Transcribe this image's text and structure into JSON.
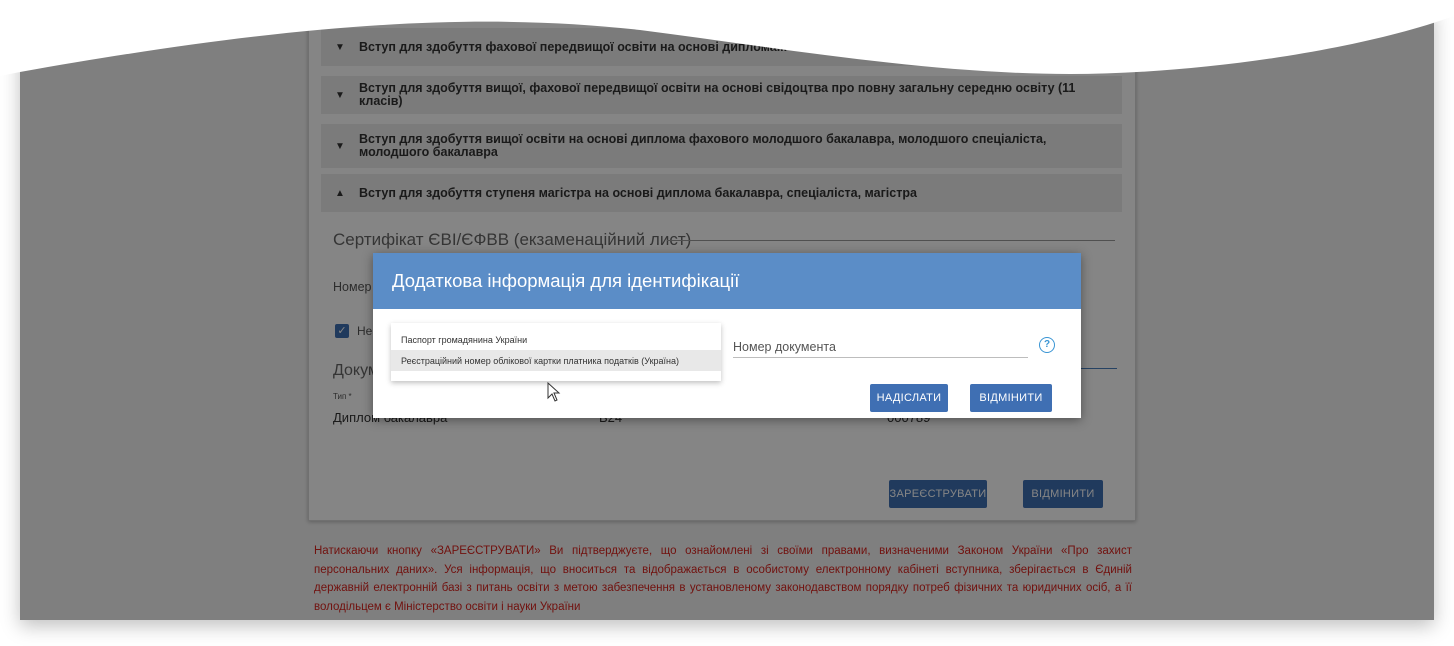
{
  "accordion": [
    {
      "label": "Вступ для здобуття фахової передвищої освіти на основі диплома...",
      "expanded": false
    },
    {
      "label": "Вступ для здобуття вищої, фахової передвищої освіти на основі свідоцтва про повну загальну середню освіту (11 класів)",
      "expanded": false
    },
    {
      "label": "Вступ для здобуття вищої освіти на основі диплома фахового молодшого бакалавра, молодшого спеціаліста, молодшого бакалавра",
      "expanded": false
    },
    {
      "label": "Вступ для здобуття ступеня магістра на основі диплома бакалавра, спеціаліста, магістра",
      "expanded": true
    }
  ],
  "section_title": "Сертифікат ЄВІ/ЄФВВ (екзаменаційний лист)",
  "number_label": "Номер",
  "checkbox_label": "Не",
  "documents_label": "Докум",
  "type_label": "Тип *",
  "type_value": "Диплом бакалавра",
  "series_value": "B24",
  "doc_number_value": "000789",
  "form_buttons": {
    "register": "ЗАРЕЄСТРУВАТИ",
    "cancel": "ВІДМІНИТИ"
  },
  "notice": "Натискаючи кнопку «ЗАРЕЄСТРУВАТИ» Ви підтверджуєте, що ознайомлені зі своїми правами, визначеними Законом України «Про захист персональних даних». Уся інформація, що вноситься та відображається в особистому електронному кабінеті вступника, зберігається в Єдиній державній електронній базі з питань освіти з метою забезпечення в установленому законодавством порядку потреб фізичних та юридичних осіб, а її володільцем є Міністерство освіти і науки України",
  "dialog": {
    "title": "Додаткова інформація для ідентифікації",
    "options": [
      "Паспорт громадянина України",
      "Реєстраційний номер облікової картки платника податків (Україна)"
    ],
    "doc_number_placeholder": "Номер документа",
    "submit": "НАДІСЛАТИ",
    "cancel": "ВІДМІНИТИ"
  },
  "colors": {
    "primary": "#3f6fb3",
    "dialog_header": "#5b8dc7",
    "notice_text": "#d9231e",
    "help_icon": "#3a95d4"
  }
}
